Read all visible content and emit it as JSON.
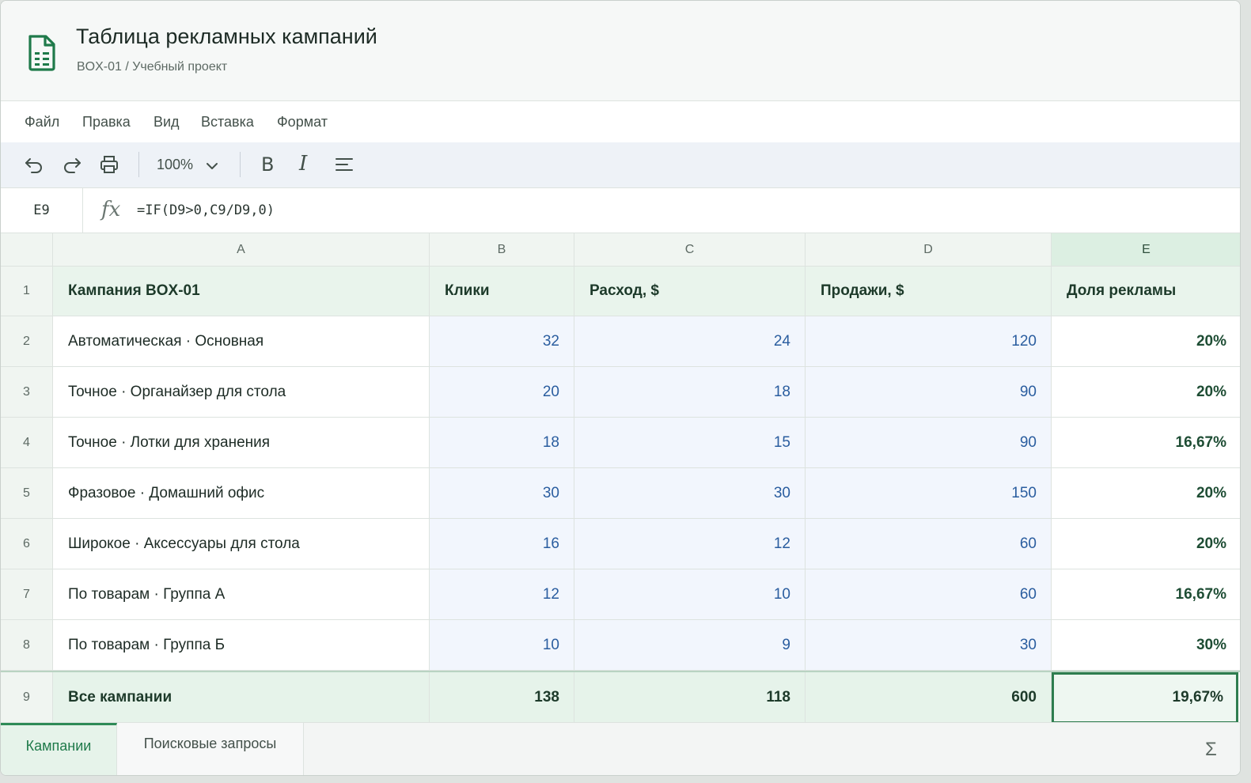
{
  "document": {
    "title": "Таблица рекламных кампаний",
    "path": "BOX-01 / Учебный проект",
    "icon": "spreadsheet-document-icon"
  },
  "menu": [
    "Файл",
    "Правка",
    "Вид",
    "Вставка",
    "Формат"
  ],
  "toolbar": {
    "zoom": "100%",
    "bold_label": "B",
    "italic_label": "I"
  },
  "formula_bar": {
    "cell_ref": "E9",
    "fx_label": "fx",
    "formula": "=IF(D9>0,C9/D9,0)"
  },
  "columns": [
    "A",
    "B",
    "C",
    "D",
    "E"
  ],
  "selected_column": "E",
  "header_row": {
    "row": "1",
    "cells": [
      "Кампания BOX-01",
      "Клики",
      "Расход, $",
      "Продажи, $",
      "Доля рекламы"
    ]
  },
  "rows": [
    {
      "row": "2",
      "name": "Автоматическая · Основная",
      "clicks": "32",
      "spend": "24",
      "sales": "120",
      "share": "20%"
    },
    {
      "row": "3",
      "name": "Точное · Органайзер для стола",
      "clicks": "20",
      "spend": "18",
      "sales": "90",
      "share": "20%"
    },
    {
      "row": "4",
      "name": "Точное · Лотки для хранения",
      "clicks": "18",
      "spend": "15",
      "sales": "90",
      "share": "16,67%"
    },
    {
      "row": "5",
      "name": "Фразовое · Домашний офис",
      "clicks": "30",
      "spend": "30",
      "sales": "150",
      "share": "20%"
    },
    {
      "row": "6",
      "name": "Широкое · Аксессуары для стола",
      "clicks": "16",
      "spend": "12",
      "sales": "60",
      "share": "20%"
    },
    {
      "row": "7",
      "name": "По товарам · Группа А",
      "clicks": "12",
      "spend": "10",
      "sales": "60",
      "share": "16,67%"
    },
    {
      "row": "8",
      "name": "По товарам · Группа Б",
      "clicks": "10",
      "spend": "9",
      "sales": "30",
      "share": "30%"
    }
  ],
  "totals": {
    "row": "9",
    "name": "Все кампании",
    "clicks": "138",
    "spend": "118",
    "sales": "600",
    "share": "19,67%"
  },
  "sheet_tabs": [
    {
      "label": "Кампании",
      "active": true
    },
    {
      "label": "Поисковые запросы",
      "active": false
    }
  ],
  "sum_label": "Σ",
  "colors": {
    "accent": "#2e7d4f",
    "number_text": "#2a5d9f",
    "header_bg": "#e9f4ec"
  }
}
